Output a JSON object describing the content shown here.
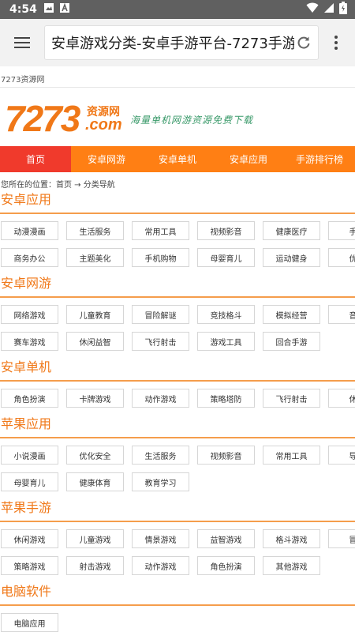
{
  "status": {
    "time": "4:54"
  },
  "browser": {
    "url_text": "安卓游戏分类-安卓手游平台-7273手游"
  },
  "site": {
    "top_text": "7273资源网",
    "logo_num": "7273",
    "logo_sub": "资源网",
    "logo_com": ".com",
    "slogan": "海量单机网游资源免费下载"
  },
  "nav": [
    "首页",
    "安卓网游",
    "安卓单机",
    "安卓应用",
    "手游排行榜"
  ],
  "breadcrumb": "您所在的位置：首页 → 分类导航",
  "sections": [
    {
      "title": "安卓应用",
      "rows": [
        [
          "动漫漫画",
          "生活服务",
          "常用工具",
          "视频影音",
          "健康医疗",
          "手机"
        ],
        [
          "商务办公",
          "主题美化",
          "手机购物",
          "母婴育儿",
          "运动健身",
          "优化"
        ]
      ]
    },
    {
      "title": "安卓网游",
      "rows": [
        [
          "网络游戏",
          "儿童教育",
          "冒险解谜",
          "竞技格斗",
          "模拟经营",
          "音乐"
        ],
        [
          "赛车游戏",
          "休闲益智",
          "飞行射击",
          "游戏工具",
          "回合手游"
        ]
      ]
    },
    {
      "title": "安卓单机",
      "rows": [
        [
          "角色扮演",
          "卡牌游戏",
          "动作游戏",
          "策略塔防",
          "飞行射击",
          "休闲"
        ]
      ]
    },
    {
      "title": "苹果应用",
      "rows": [
        [
          "小说漫画",
          "优化安全",
          "生活服务",
          "视频影音",
          "常用工具",
          "导航"
        ],
        [
          "母婴育儿",
          "健康体育",
          "教育学习"
        ]
      ]
    },
    {
      "title": "苹果手游",
      "rows": [
        [
          "休闲游戏",
          "儿童游戏",
          "情景游戏",
          "益智游戏",
          "格斗游戏",
          "冒险"
        ],
        [
          "策略游戏",
          "射击游戏",
          "动作游戏",
          "角色扮演",
          "其他游戏"
        ]
      ]
    },
    {
      "title": "电脑软件",
      "rows": [
        [
          "电脑应用"
        ]
      ]
    }
  ]
}
